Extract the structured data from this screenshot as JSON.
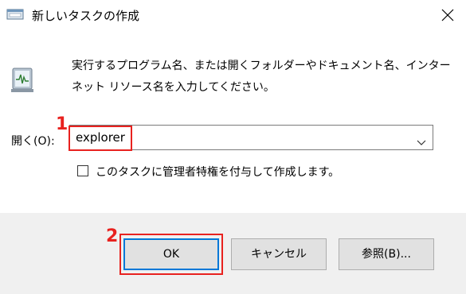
{
  "window": {
    "title": "新しいタスクの作成",
    "icon": "run-dialog-icon",
    "close_icon": "close-icon"
  },
  "main": {
    "icon": "run-program-icon",
    "description": "実行するプログラム名、または開くフォルダーやドキュメント名、インターネット リソース名を入力してください。"
  },
  "open_field": {
    "label": "開く(O):",
    "value": "explorer",
    "dropdown_icon": "chevron-down-icon"
  },
  "admin_checkbox": {
    "label": "このタスクに管理者特権を付与して作成します。",
    "checked": false
  },
  "buttons": {
    "ok": "OK",
    "cancel": "キャンセル",
    "browse": "参照(B)..."
  },
  "annotations": {
    "step1": "1",
    "step2": "2",
    "color": "#e8221f"
  },
  "colors": {
    "focus_border": "#0078d7",
    "footer_bg": "#f0f0f0",
    "button_bg": "#e1e1e1"
  }
}
